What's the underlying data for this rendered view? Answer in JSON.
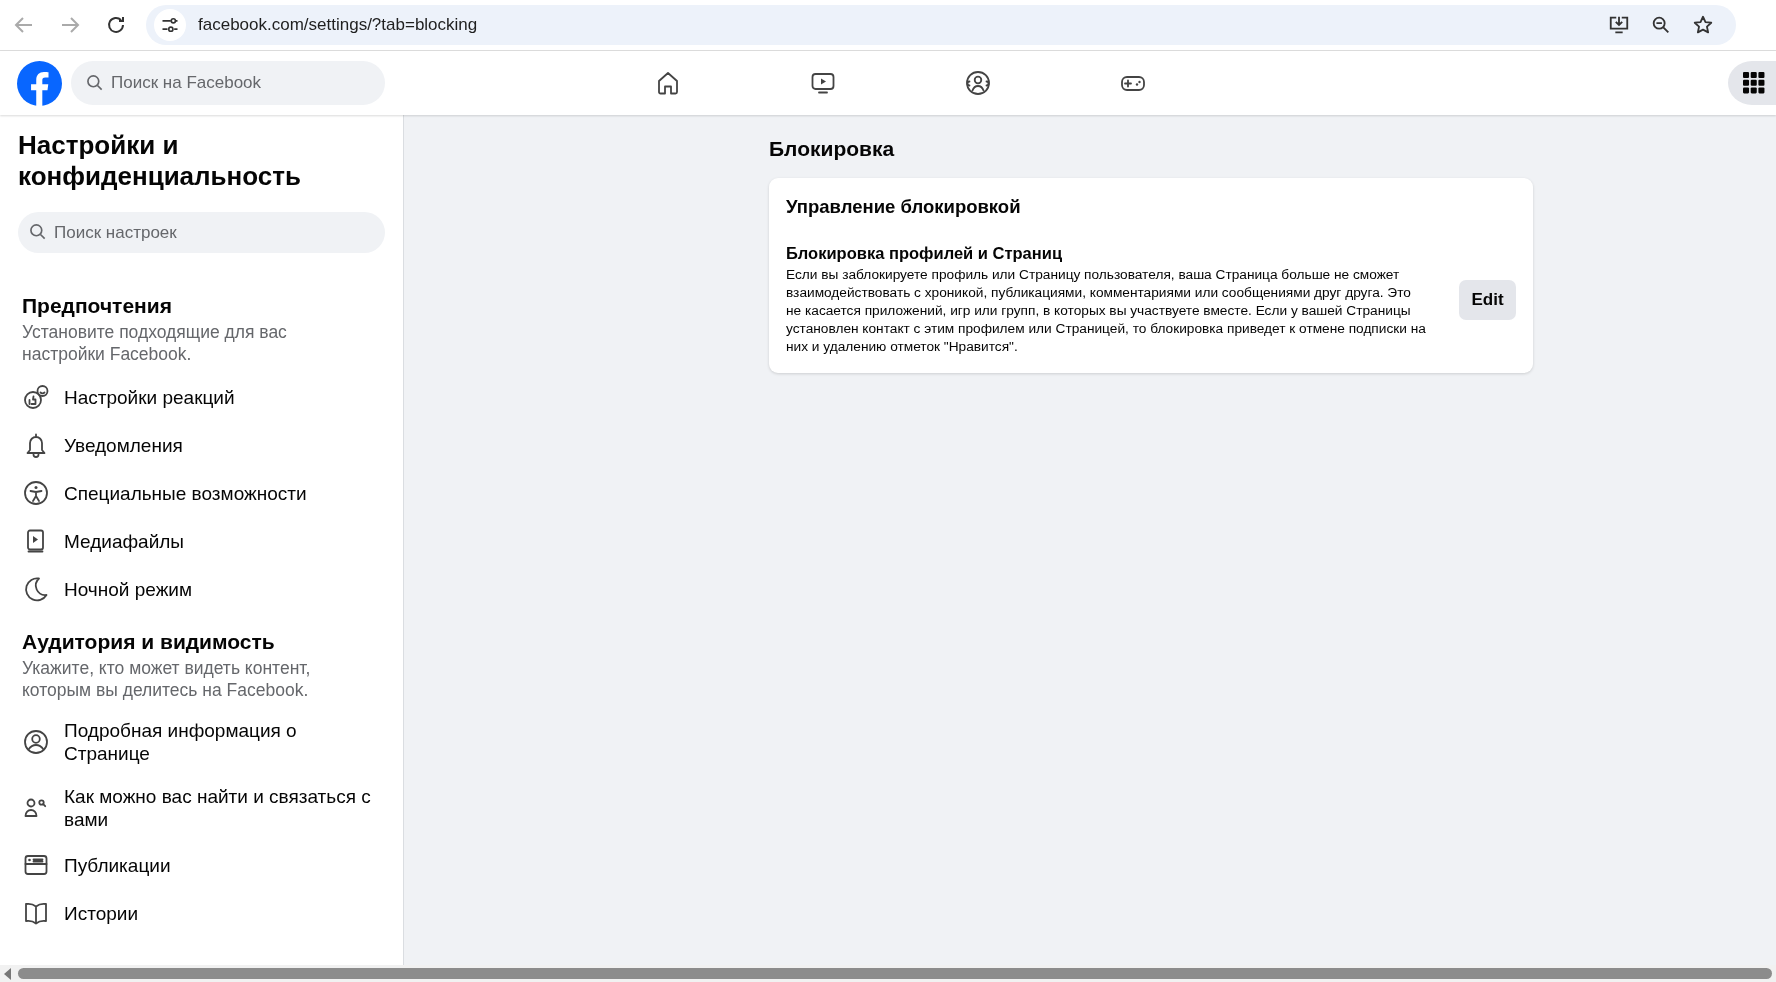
{
  "browser": {
    "url": "facebook.com/settings/?tab=blocking"
  },
  "topbar": {
    "search": {
      "placeholder": "Поиск на Facebook"
    }
  },
  "sidebar": {
    "title": "Настройки и конфиденциальность",
    "search": {
      "placeholder": "Поиск настроек"
    },
    "sections": [
      {
        "heading": "Предпочтения",
        "description": "Установите подходящие для вас настройки Facebook.",
        "items": [
          {
            "label": "Настройки реакций"
          },
          {
            "label": "Уведомления"
          },
          {
            "label": "Специальные возможности"
          },
          {
            "label": "Медиафайлы"
          },
          {
            "label": "Ночной режим"
          }
        ]
      },
      {
        "heading": "Аудитория и видимость",
        "description": "Укажите, кто может видеть контент, которым вы делитесь на Facebook.",
        "items": [
          {
            "label": "Подробная информация о Странице"
          },
          {
            "label": "Как можно вас найти и связаться с вами"
          },
          {
            "label": "Публикации"
          },
          {
            "label": "Истории"
          }
        ]
      }
    ]
  },
  "main": {
    "title": "Блокировка",
    "card": {
      "title": "Управление блокировкой",
      "setting": {
        "title": "Блокировка профилей и Страниц",
        "description": "Если вы заблокируете профиль или Страницу пользователя, ваша Страница больше не сможет взаимодействовать с хроникой, публикациями, комментариями или сообщениями друг друга. Это не касается приложений, игр или групп, в которых вы участвуете вместе. Если у вашей Страницы установлен контакт с этим профилем или Страницей, то блокировка приведет к отмене подписки на них и удалению отметок \"Нравится\".",
        "button": "Edit"
      }
    }
  }
}
